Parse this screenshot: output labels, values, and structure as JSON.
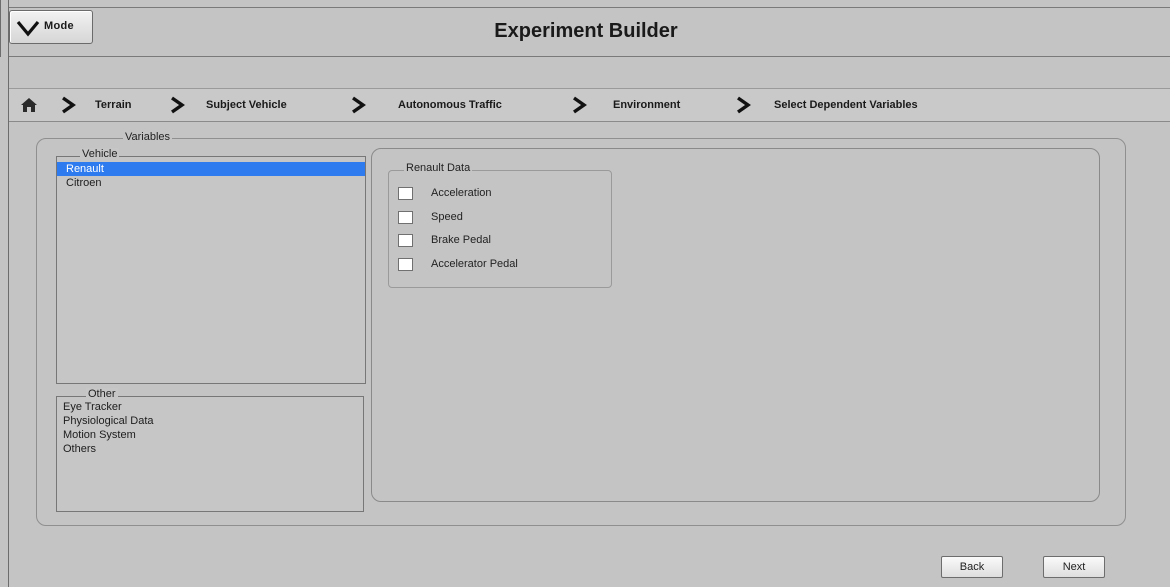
{
  "header": {
    "mode_label": "Mode",
    "title": "Experiment Builder"
  },
  "breadcrumb": {
    "items": [
      {
        "label": "Terrain"
      },
      {
        "label": "Subject Vehicle"
      },
      {
        "label": "Autonomous Traffic"
      },
      {
        "label": "Environment"
      },
      {
        "label": "Select Dependent Variables"
      }
    ]
  },
  "variables": {
    "legend": "Variables",
    "vehicle": {
      "legend": "Vehicle",
      "items": [
        "Renault",
        "Citroen"
      ],
      "selected": "Renault"
    },
    "other": {
      "legend": "Other",
      "items": [
        "Eye Tracker",
        "Physiological Data",
        "Motion System",
        "Others"
      ]
    }
  },
  "data_panel": {
    "legend": "Renault Data",
    "options": [
      {
        "label": "Acceleration",
        "checked": false
      },
      {
        "label": "Speed",
        "checked": false
      },
      {
        "label": "Brake Pedal",
        "checked": false
      },
      {
        "label": "Accelerator Pedal",
        "checked": false
      }
    ]
  },
  "footer": {
    "back_label": "Back",
    "next_label": "Next"
  },
  "colors": {
    "background": "#c4c4c4",
    "selection": "#2e7bf0"
  }
}
